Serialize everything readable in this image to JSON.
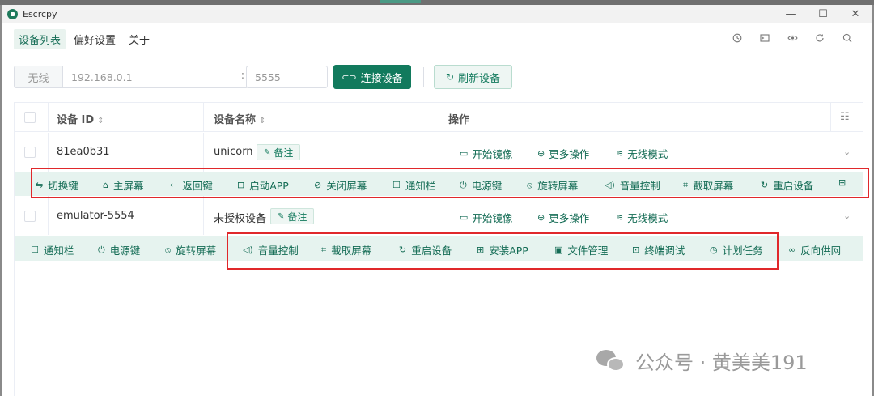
{
  "window": {
    "title": "Escrcpy"
  },
  "nav": {
    "tabs": [
      {
        "label": "设备列表"
      },
      {
        "label": "偏好设置"
      },
      {
        "label": "关于"
      }
    ]
  },
  "connect": {
    "mode_label": "无线",
    "ip_placeholder": "192.168.0.1",
    "port_placeholder": "5555",
    "connect_label": "连接设备",
    "refresh_label": "刷新设备"
  },
  "table": {
    "headers": {
      "device_id": "设备 ID",
      "device_name": "设备名称",
      "actions": "操作"
    },
    "rows": [
      {
        "id": "81ea0b31",
        "name": "unicorn",
        "note_label": "备注",
        "ops": [
          "开始镜像",
          "更多操作",
          "无线模式"
        ]
      },
      {
        "id": "emulator-5554",
        "name": "未授权设备",
        "note_label": "备注",
        "ops": [
          "开始镜像",
          "更多操作",
          "无线模式"
        ]
      }
    ],
    "strip1": [
      "切换键",
      "主屏幕",
      "返回键",
      "启动APP",
      "关闭屏幕",
      "通知栏",
      "电源键",
      "旋转屏幕",
      "音量控制",
      "截取屏幕",
      "重启设备"
    ],
    "strip2": [
      "通知栏",
      "电源键",
      "旋转屏幕",
      "音量控制",
      "截取屏幕",
      "重启设备",
      "安装APP",
      "文件管理",
      "终端调试",
      "计划任务",
      "反向供网"
    ]
  },
  "watermark": {
    "text": "公众号 · 黄美美191"
  },
  "colors": {
    "accent": "#127a5d",
    "highlight": "#e0282b"
  }
}
